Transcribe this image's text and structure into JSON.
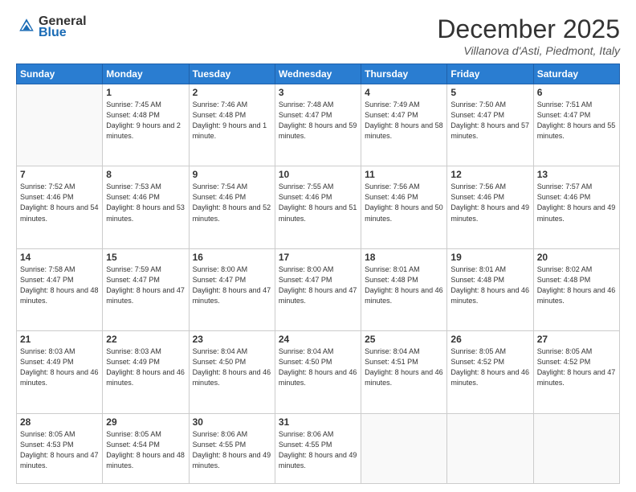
{
  "header": {
    "logo_line1": "General",
    "logo_line2": "Blue",
    "month_title": "December 2025",
    "location": "Villanova d'Asti, Piedmont, Italy"
  },
  "days_of_week": [
    "Sunday",
    "Monday",
    "Tuesday",
    "Wednesday",
    "Thursday",
    "Friday",
    "Saturday"
  ],
  "weeks": [
    [
      {
        "day": "",
        "empty": true
      },
      {
        "day": "1",
        "sunrise": "7:45 AM",
        "sunset": "4:48 PM",
        "daylight": "9 hours and 2 minutes."
      },
      {
        "day": "2",
        "sunrise": "7:46 AM",
        "sunset": "4:48 PM",
        "daylight": "9 hours and 1 minute."
      },
      {
        "day": "3",
        "sunrise": "7:48 AM",
        "sunset": "4:47 PM",
        "daylight": "8 hours and 59 minutes."
      },
      {
        "day": "4",
        "sunrise": "7:49 AM",
        "sunset": "4:47 PM",
        "daylight": "8 hours and 58 minutes."
      },
      {
        "day": "5",
        "sunrise": "7:50 AM",
        "sunset": "4:47 PM",
        "daylight": "8 hours and 57 minutes."
      },
      {
        "day": "6",
        "sunrise": "7:51 AM",
        "sunset": "4:47 PM",
        "daylight": "8 hours and 55 minutes."
      }
    ],
    [
      {
        "day": "7",
        "sunrise": "7:52 AM",
        "sunset": "4:46 PM",
        "daylight": "8 hours and 54 minutes."
      },
      {
        "day": "8",
        "sunrise": "7:53 AM",
        "sunset": "4:46 PM",
        "daylight": "8 hours and 53 minutes."
      },
      {
        "day": "9",
        "sunrise": "7:54 AM",
        "sunset": "4:46 PM",
        "daylight": "8 hours and 52 minutes."
      },
      {
        "day": "10",
        "sunrise": "7:55 AM",
        "sunset": "4:46 PM",
        "daylight": "8 hours and 51 minutes."
      },
      {
        "day": "11",
        "sunrise": "7:56 AM",
        "sunset": "4:46 PM",
        "daylight": "8 hours and 50 minutes."
      },
      {
        "day": "12",
        "sunrise": "7:56 AM",
        "sunset": "4:46 PM",
        "daylight": "8 hours and 49 minutes."
      },
      {
        "day": "13",
        "sunrise": "7:57 AM",
        "sunset": "4:46 PM",
        "daylight": "8 hours and 49 minutes."
      }
    ],
    [
      {
        "day": "14",
        "sunrise": "7:58 AM",
        "sunset": "4:47 PM",
        "daylight": "8 hours and 48 minutes."
      },
      {
        "day": "15",
        "sunrise": "7:59 AM",
        "sunset": "4:47 PM",
        "daylight": "8 hours and 47 minutes."
      },
      {
        "day": "16",
        "sunrise": "8:00 AM",
        "sunset": "4:47 PM",
        "daylight": "8 hours and 47 minutes."
      },
      {
        "day": "17",
        "sunrise": "8:00 AM",
        "sunset": "4:47 PM",
        "daylight": "8 hours and 47 minutes."
      },
      {
        "day": "18",
        "sunrise": "8:01 AM",
        "sunset": "4:48 PM",
        "daylight": "8 hours and 46 minutes."
      },
      {
        "day": "19",
        "sunrise": "8:01 AM",
        "sunset": "4:48 PM",
        "daylight": "8 hours and 46 minutes."
      },
      {
        "day": "20",
        "sunrise": "8:02 AM",
        "sunset": "4:48 PM",
        "daylight": "8 hours and 46 minutes."
      }
    ],
    [
      {
        "day": "21",
        "sunrise": "8:03 AM",
        "sunset": "4:49 PM",
        "daylight": "8 hours and 46 minutes."
      },
      {
        "day": "22",
        "sunrise": "8:03 AM",
        "sunset": "4:49 PM",
        "daylight": "8 hours and 46 minutes."
      },
      {
        "day": "23",
        "sunrise": "8:04 AM",
        "sunset": "4:50 PM",
        "daylight": "8 hours and 46 minutes."
      },
      {
        "day": "24",
        "sunrise": "8:04 AM",
        "sunset": "4:50 PM",
        "daylight": "8 hours and 46 minutes."
      },
      {
        "day": "25",
        "sunrise": "8:04 AM",
        "sunset": "4:51 PM",
        "daylight": "8 hours and 46 minutes."
      },
      {
        "day": "26",
        "sunrise": "8:05 AM",
        "sunset": "4:52 PM",
        "daylight": "8 hours and 46 minutes."
      },
      {
        "day": "27",
        "sunrise": "8:05 AM",
        "sunset": "4:52 PM",
        "daylight": "8 hours and 47 minutes."
      }
    ],
    [
      {
        "day": "28",
        "sunrise": "8:05 AM",
        "sunset": "4:53 PM",
        "daylight": "8 hours and 47 minutes."
      },
      {
        "day": "29",
        "sunrise": "8:05 AM",
        "sunset": "4:54 PM",
        "daylight": "8 hours and 48 minutes."
      },
      {
        "day": "30",
        "sunrise": "8:06 AM",
        "sunset": "4:55 PM",
        "daylight": "8 hours and 49 minutes."
      },
      {
        "day": "31",
        "sunrise": "8:06 AM",
        "sunset": "4:55 PM",
        "daylight": "8 hours and 49 minutes."
      },
      {
        "day": "",
        "empty": true
      },
      {
        "day": "",
        "empty": true
      },
      {
        "day": "",
        "empty": true
      }
    ]
  ]
}
